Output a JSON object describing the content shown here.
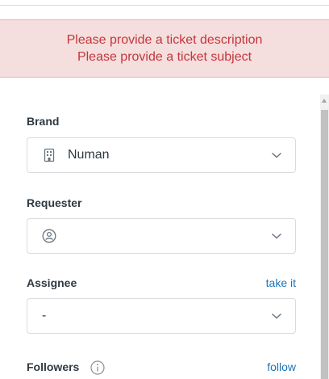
{
  "errors": [
    "Please provide a ticket description",
    "Please provide a ticket subject"
  ],
  "fields": {
    "brand": {
      "label": "Brand",
      "value": "Numan",
      "icon": "building-icon"
    },
    "requester": {
      "label": "Requester",
      "value": "",
      "icon": "user-circle-icon"
    },
    "assignee": {
      "label": "Assignee",
      "value": "-",
      "link": "take it"
    },
    "followers": {
      "label": "Followers",
      "link": "follow",
      "icon": "info-icon"
    }
  },
  "colors": {
    "error_text": "#c4363a",
    "error_bg": "#f5dede",
    "link": "#1f73b7"
  }
}
